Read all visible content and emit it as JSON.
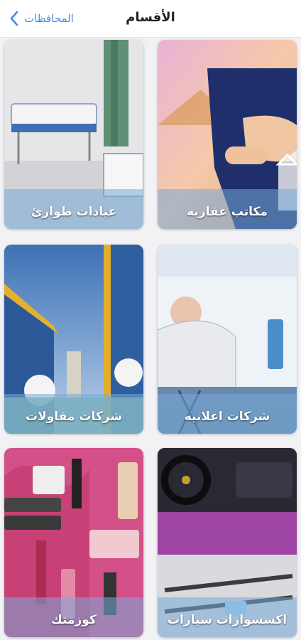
{
  "header": {
    "title": "الأقسام",
    "back_label": "المحافظات"
  },
  "categories": [
    {
      "label": "مكاتب عقاريه"
    },
    {
      "label": "عيادات طوارئ"
    },
    {
      "label": "شركات اعلانيه"
    },
    {
      "label": "شركات مقاولات"
    },
    {
      "label": "اكسسوارات سيارات"
    },
    {
      "label": "كوزمتك"
    }
  ],
  "colors": {
    "accent": "#3b8ee6",
    "label_band": "#78aad7"
  }
}
